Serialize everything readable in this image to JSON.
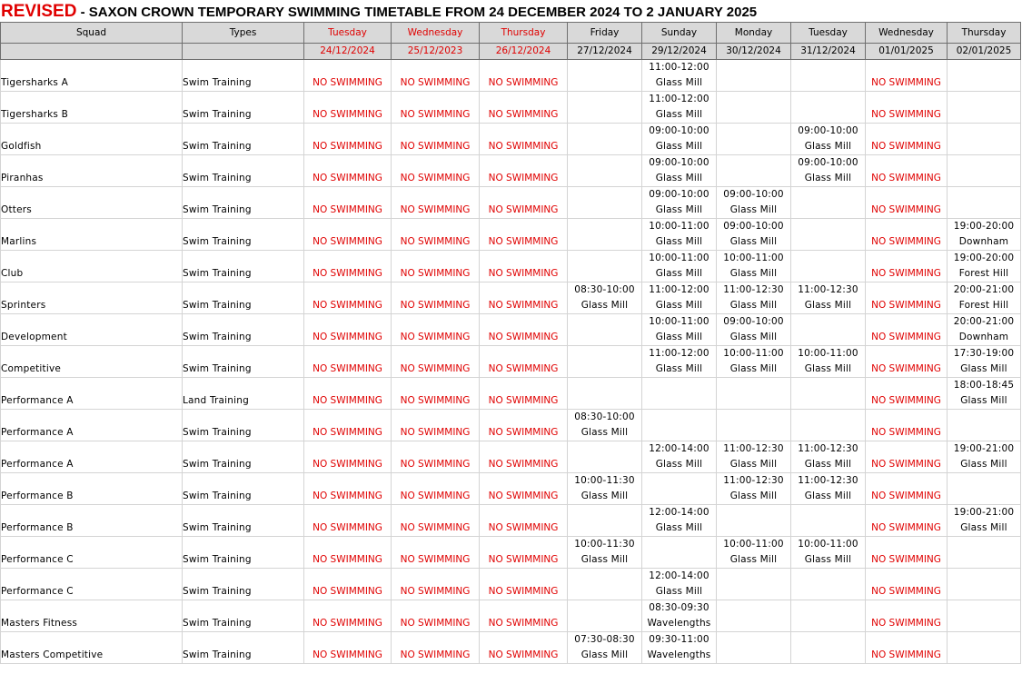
{
  "title": {
    "revised": "REVISED",
    "rest": " - SAXON CROWN TEMPORARY SWIMMING TIMETABLE FROM 24 DECEMBER 2024 TO 2 JANUARY 2025"
  },
  "colors": {
    "accent_red": "#e00000",
    "header_bg": "#d9d9d9"
  },
  "labels": {
    "no_swimming": "NO SWIMMING"
  },
  "columns": [
    {
      "day": "Squad",
      "date": "",
      "closed": false
    },
    {
      "day": "Types",
      "date": "",
      "closed": false
    },
    {
      "day": "Tuesday",
      "date": "24/12/2024",
      "closed": true
    },
    {
      "day": "Wednesday",
      "date": "25/12/2023",
      "closed": true
    },
    {
      "day": "Thursday",
      "date": "26/12/2024",
      "closed": true
    },
    {
      "day": "Friday",
      "date": "27/12/2024",
      "closed": false
    },
    {
      "day": "Sunday",
      "date": "29/12/2024",
      "closed": false
    },
    {
      "day": "Monday",
      "date": "30/12/2024",
      "closed": false
    },
    {
      "day": "Tuesday",
      "date": "31/12/2024",
      "closed": false
    },
    {
      "day": "Wednesday",
      "date": "01/01/2025",
      "closed": false
    },
    {
      "day": "Thursday",
      "date": "02/01/2025",
      "closed": false
    }
  ],
  "rows": [
    {
      "squad": "Tigersharks A",
      "type": "Swim Training",
      "cells": [
        null,
        [
          "11:00-12:00",
          "Glass Mill"
        ],
        null,
        null,
        null
      ]
    },
    {
      "squad": "Tigersharks  B",
      "type": "Swim Training",
      "cells": [
        null,
        [
          "11:00-12:00",
          "Glass Mill"
        ],
        null,
        null,
        null
      ]
    },
    {
      "squad": "Goldfish",
      "type": "Swim Training",
      "cells": [
        null,
        [
          "09:00-10:00",
          "Glass Mill"
        ],
        null,
        [
          "09:00-10:00",
          "Glass Mill"
        ],
        null
      ]
    },
    {
      "squad": "Piranhas",
      "type": "Swim Training",
      "cells": [
        null,
        [
          "09:00-10:00",
          "Glass Mill"
        ],
        null,
        [
          "09:00-10:00",
          "Glass Mill"
        ],
        null
      ]
    },
    {
      "squad": "Otters",
      "type": "Swim Training",
      "cells": [
        null,
        [
          "09:00-10:00",
          "Glass Mill"
        ],
        [
          "09:00-10:00",
          "Glass Mill"
        ],
        null,
        null
      ]
    },
    {
      "squad": "Marlins",
      "type": "Swim Training",
      "cells": [
        null,
        [
          "10:00-11:00",
          "Glass Mill"
        ],
        [
          "09:00-10:00",
          "Glass Mill"
        ],
        null,
        [
          "19:00-20:00",
          "Downham"
        ]
      ]
    },
    {
      "squad": "Club",
      "type": "Swim Training",
      "cells": [
        null,
        [
          "10:00-11:00",
          "Glass Mill"
        ],
        [
          "10:00-11:00",
          "Glass Mill"
        ],
        null,
        [
          "19:00-20:00",
          "Forest Hill"
        ]
      ]
    },
    {
      "squad": "Sprinters",
      "type": "Swim Training",
      "cells": [
        [
          "08:30-10:00",
          "Glass Mill"
        ],
        [
          "11:00-12:00",
          "Glass Mill"
        ],
        [
          "11:00-12:30",
          "Glass Mill"
        ],
        [
          "11:00-12:30",
          "Glass Mill"
        ],
        [
          "20:00-21:00",
          "Forest Hill"
        ]
      ]
    },
    {
      "squad": "Development",
      "type": "Swim Training",
      "cells": [
        null,
        [
          "10:00-11:00",
          "Glass Mill"
        ],
        [
          "09:00-10:00",
          "Glass Mill"
        ],
        null,
        [
          "20:00-21:00",
          "Downham"
        ]
      ]
    },
    {
      "squad": "Competitive",
      "type": "Swim Training",
      "cells": [
        null,
        [
          "11:00-12:00",
          "Glass Mill"
        ],
        [
          "10:00-11:00",
          "Glass Mill"
        ],
        [
          "10:00-11:00",
          "Glass Mill"
        ],
        [
          "17:30-19:00",
          "Glass Mill"
        ]
      ]
    },
    {
      "squad": "Performance A",
      "type": "Land Training",
      "cells": [
        null,
        null,
        null,
        null,
        [
          "18:00-18:45",
          "Glass Mill"
        ]
      ]
    },
    {
      "squad": "Performance A",
      "type": "Swim Training",
      "cells": [
        [
          "08:30-10:00",
          "Glass Mill"
        ],
        null,
        null,
        null,
        null
      ]
    },
    {
      "squad": "Performance A",
      "type": "Swim Training",
      "cells": [
        null,
        [
          "12:00-14:00",
          "Glass Mill"
        ],
        [
          "11:00-12:30",
          "Glass Mill"
        ],
        [
          "11:00-12:30",
          "Glass Mill"
        ],
        [
          "19:00-21:00",
          "Glass Mill"
        ]
      ]
    },
    {
      "squad": "Performance B",
      "type": "Swim Training",
      "cells": [
        [
          "10:00-11:30",
          "Glass Mill"
        ],
        null,
        [
          "11:00-12:30",
          "Glass Mill"
        ],
        [
          "11:00-12:30",
          "Glass Mill"
        ],
        null
      ]
    },
    {
      "squad": "Performance B",
      "type": "Swim Training",
      "cells": [
        null,
        [
          "12:00-14:00",
          "Glass Mill"
        ],
        null,
        null,
        [
          "19:00-21:00",
          "Glass Mill"
        ]
      ]
    },
    {
      "squad": "Performance C",
      "type": "Swim Training",
      "cells": [
        [
          "10:00-11:30",
          "Glass Mill"
        ],
        null,
        [
          "10:00-11:00",
          "Glass Mill"
        ],
        [
          "10:00-11:00",
          "Glass Mill"
        ],
        null
      ]
    },
    {
      "squad": "Performance C",
      "type": "Swim Training",
      "cells": [
        null,
        [
          "12:00-14:00",
          "Glass Mill"
        ],
        null,
        null,
        null
      ]
    },
    {
      "squad": "Masters Fitness",
      "type": "Swim Training",
      "cells": [
        null,
        [
          "08:30-09:30",
          "Wavelengths"
        ],
        null,
        null,
        null
      ]
    },
    {
      "squad": "Masters Competitive",
      "type": "Swim Training",
      "cells": [
        [
          "07:30-08:30",
          "Glass Mill"
        ],
        [
          "09:30-11:00",
          "Wavelengths"
        ],
        null,
        null,
        null
      ]
    }
  ]
}
